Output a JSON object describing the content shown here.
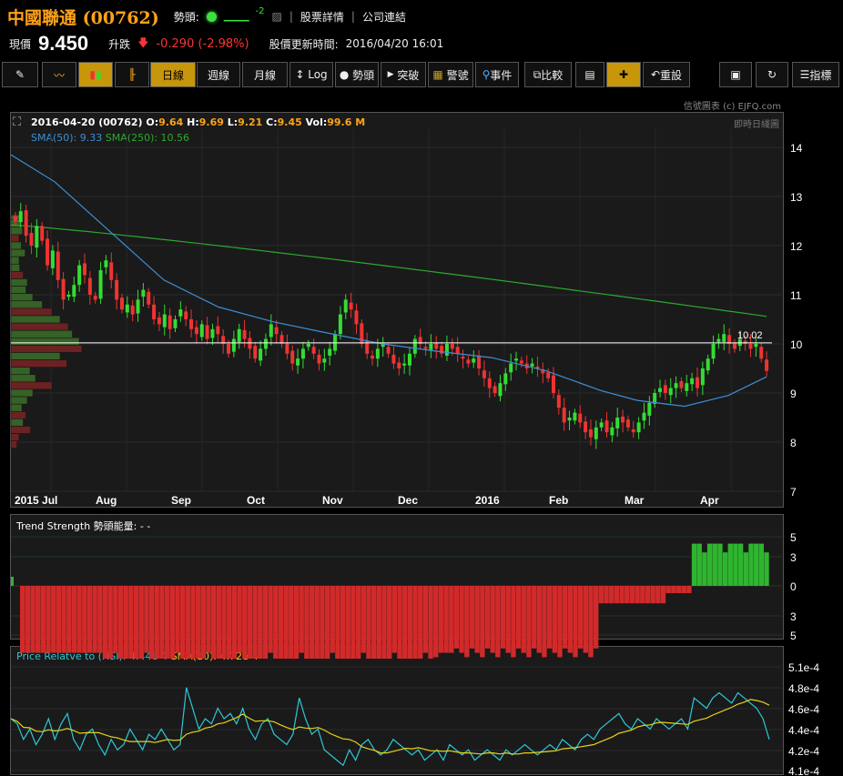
{
  "header": {
    "title": "中國聯通 (00762)",
    "trend_label": "勢頭:",
    "trend_value": "-2",
    "stock_detail": "股票詳情",
    "company_link": "公司連結",
    "price_label": "現價",
    "price": "9.450",
    "change_label": "升跌",
    "change": "-0.290 (-2.98%)",
    "update_label": "股價更新時間:",
    "update_time": "2016/04/20 16:01"
  },
  "toolbar": {
    "daily": "日線",
    "weekly": "週線",
    "monthly": "月線",
    "log": "Log",
    "trend": "勢頭",
    "breakout": "突破",
    "signal": "警號",
    "event": "事件",
    "compare": "比較",
    "reset": "重設",
    "indicator": "指標"
  },
  "brand": "信號圖表 (c) EJFQ.com",
  "main_chart": {
    "info_date": "2016-04-20",
    "info_code": "(00762)",
    "o_label": "O:",
    "o": "9.64",
    "h_label": "H:",
    "h": "9.69",
    "l_label": "L:",
    "l": "9.21",
    "c_label": "C:",
    "c": "9.45",
    "vol_label": "Vol:",
    "vol": "99.6 M",
    "sma50": "SMA(50): 9.33",
    "sma250": "SMA(250): 10.56",
    "realtime": "即時日綫圖",
    "ref_line": "10.02",
    "colors": {
      "up": "#33dd33",
      "down": "#ee3333",
      "sma50": "#3d8fd6",
      "sma250": "#2ea82e",
      "volprofile_up": "#3b6e2a",
      "volprofile_down": "#7a2424"
    }
  },
  "chart_data": [
    {
      "type": "candlestick",
      "title": "",
      "x_ticks": [
        "2015 Jul",
        "Aug",
        "Sep",
        "Oct",
        "Nov",
        "Dec",
        "2016",
        "Feb",
        "Mar",
        "Apr"
      ],
      "y_ticks": [
        "14",
        "13",
        "12",
        "11",
        "10",
        "9",
        "8",
        "7"
      ],
      "ylim": [
        7,
        14.4
      ],
      "close": [
        12.5,
        12.7,
        12.2,
        12.0,
        12.4,
        12.1,
        11.6,
        11.9,
        11.3,
        10.9,
        11.0,
        11.2,
        11.6,
        11.4,
        11.0,
        10.9,
        11.5,
        11.7,
        11.3,
        10.9,
        10.7,
        10.8,
        10.6,
        10.9,
        11.1,
        10.8,
        10.5,
        10.4,
        10.6,
        10.3,
        10.5,
        10.7,
        10.5,
        10.3,
        10.2,
        10.4,
        10.1,
        10.3,
        10.2,
        10.0,
        9.8,
        10.1,
        10.3,
        10.1,
        9.9,
        9.7,
        9.9,
        10.1,
        10.4,
        10.2,
        10.0,
        9.8,
        9.6,
        9.7,
        9.9,
        10.0,
        9.8,
        9.6,
        9.7,
        9.9,
        10.2,
        10.6,
        10.9,
        10.7,
        10.4,
        10.0,
        9.8,
        9.7,
        9.9,
        10.0,
        9.8,
        9.6,
        9.5,
        9.6,
        9.8,
        10.1,
        10.0,
        9.9,
        10.0,
        9.9,
        9.8,
        10.0,
        9.9,
        9.8,
        9.7,
        9.6,
        9.7,
        9.5,
        9.3,
        9.1,
        9.0,
        9.2,
        9.4,
        9.6,
        9.7,
        9.6,
        9.5,
        9.6,
        9.5,
        9.4,
        9.3,
        9.0,
        8.7,
        8.4,
        8.5,
        8.6,
        8.4,
        8.2,
        8.1,
        8.3,
        8.4,
        8.2,
        8.3,
        8.5,
        8.4,
        8.3,
        8.2,
        8.4,
        8.6,
        8.8,
        9.0,
        9.1,
        9.0,
        9.1,
        9.2,
        9.1,
        9.2,
        9.3,
        9.1,
        9.5,
        9.7,
        10.0,
        10.1,
        10.2,
        10.0,
        9.9,
        10.1,
        10.0,
        9.9,
        10.0,
        9.7,
        9.45
      ],
      "sma_50_label": "SMA(50)",
      "sma_250_label": "SMA(250)",
      "sma_50_last": 9.33,
      "sma_250_last": 10.56,
      "last": {
        "o": 9.64,
        "h": 9.69,
        "l": 9.21,
        "c": 9.45
      }
    },
    {
      "type": "bar",
      "title": "Trend Strength 勢頭能量: - -",
      "y_ticks": [
        "5",
        "3",
        "0",
        "3",
        "5"
      ],
      "ylim": [
        -5,
        5
      ]
    },
    {
      "type": "line",
      "title": "Price Relatve to (HSI): 4.44e-4",
      "sma_label": "SMA(10): 4.72e-4",
      "y_ticks": [
        "5.1e-4",
        "4.8e-4",
        "4.6e-4",
        "4.4e-4",
        "4.2e-4",
        "4.1e-4"
      ],
      "ylim": [
        4.1,
        5.1
      ],
      "colors": {
        "ratio": "#2ec8d8",
        "sma": "#e6d21a"
      }
    }
  ]
}
